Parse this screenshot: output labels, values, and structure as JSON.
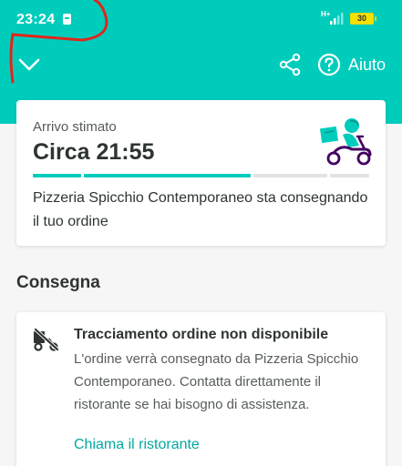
{
  "status_bar": {
    "time": "23:24",
    "network": "H+",
    "battery": "30"
  },
  "toolbar": {
    "collapse_icon": "chevron-down-icon",
    "share_icon": "share-icon",
    "help_icon": "question-circle-icon",
    "help_label": "Aiuto"
  },
  "eta_card": {
    "label": "Arrivo stimato",
    "time": "Circa 21:55",
    "status": "Pizzeria Spicchio Contemporaneo sta consegnando il tuo ordine",
    "progress_segments": 4,
    "illustration": "scooter-rider-icon"
  },
  "delivery": {
    "section_title": "Consegna",
    "tracking_icon": "tracking-unavailable-icon",
    "title": "Tracciamento ordine non disponibile",
    "body": "L'ordine verrà consegnato da Pizzeria Spicchio Contemporaneo. Contatta direttamente il ristorante se hai bisogno di assistenza.",
    "call_label": "Chiama il ristorante"
  },
  "colors": {
    "brand_teal": "#00ccbc",
    "link_teal": "#00a8a0",
    "rider_purple": "#440063",
    "text_dark": "#2e3333",
    "annotation_red": "#e0261b"
  }
}
